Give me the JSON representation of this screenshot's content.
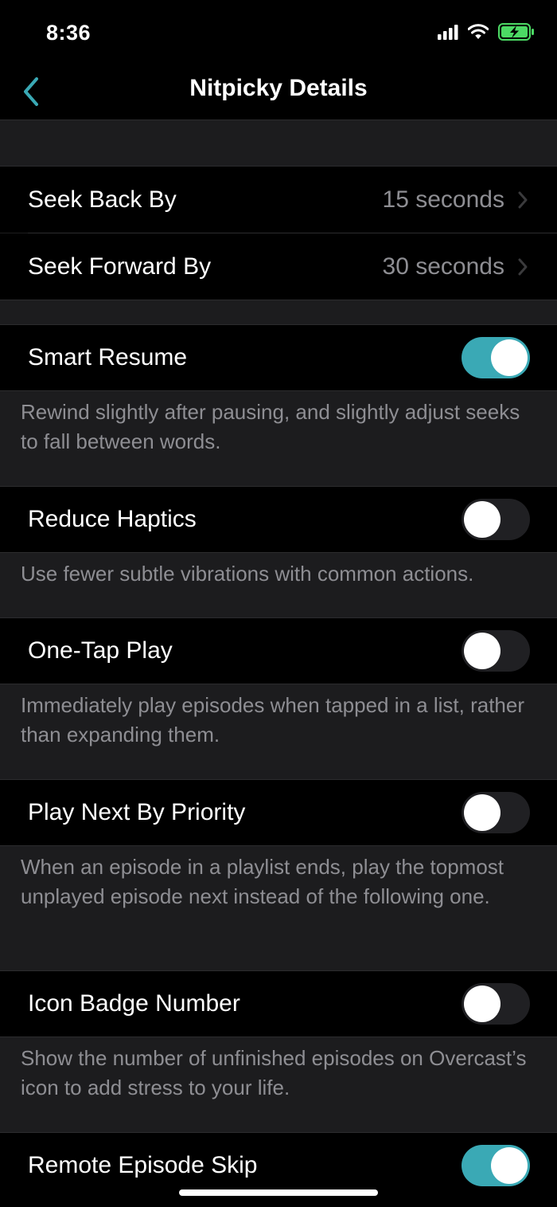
{
  "status_bar": {
    "time": "8:36"
  },
  "nav": {
    "title": "Nitpicky Details"
  },
  "seek": {
    "back": {
      "label": "Seek Back By",
      "value": "15 seconds"
    },
    "forward": {
      "label": "Seek Forward By",
      "value": "30 seconds"
    }
  },
  "settings": [
    {
      "label": "Smart Resume",
      "on": true,
      "footer": "Rewind slightly after pausing, and slightly adjust seeks to fall between words."
    },
    {
      "label": "Reduce Haptics",
      "on": false,
      "footer": "Use fewer subtle vibrations with common actions."
    },
    {
      "label": "One-Tap Play",
      "on": false,
      "footer": "Immediately play episodes when tapped in a list, rather than expanding them."
    },
    {
      "label": "Play Next By Priority",
      "on": false,
      "footer": "When an episode in a playlist ends, play the topmost unplayed episode next instead of the following one."
    },
    {
      "label": "Icon Badge Number",
      "on": false,
      "footer": "Show the number of unfinished episodes on Overcast’s icon to add stress to your life."
    },
    {
      "label": "Remote Episode Skip",
      "on": true
    }
  ],
  "colors": {
    "accent": "#3aa9b5",
    "battery": "#4cd964"
  }
}
